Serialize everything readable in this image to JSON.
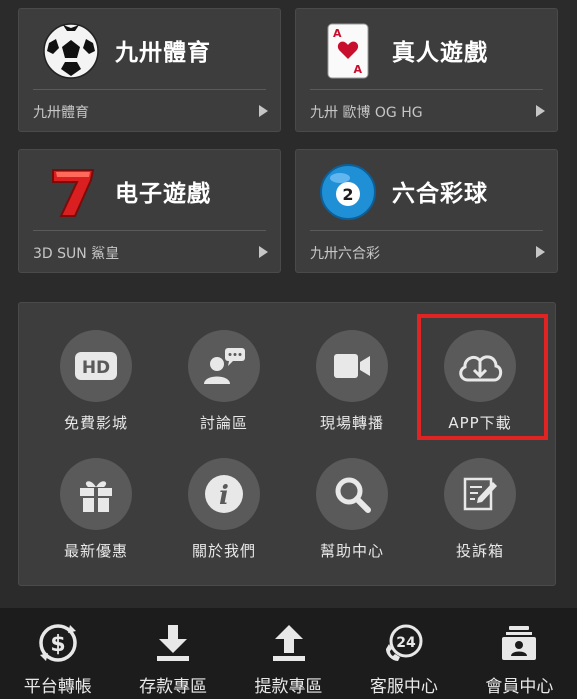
{
  "cards": [
    {
      "title": "九卅體育",
      "sub": "九卅體育",
      "icon": "soccer-ball-icon"
    },
    {
      "title": "真人遊戲",
      "sub": "九卅 歐博 OG HG",
      "icon": "playing-card-icon"
    },
    {
      "title": "电子遊戲",
      "sub": "3D SUN 鯊皇",
      "icon": "lucky-seven-icon"
    },
    {
      "title": "六合彩球",
      "sub": "九卅六合彩",
      "icon": "lottery-ball-icon"
    }
  ],
  "lottery_ball_number": "2",
  "playing_card": {
    "rank": "A"
  },
  "services": [
    {
      "label": "免費影城",
      "icon": "hd-icon",
      "hd_text": "HD"
    },
    {
      "label": "討論區",
      "icon": "chat-user-icon"
    },
    {
      "label": "現場轉播",
      "icon": "video-camera-icon"
    },
    {
      "label": "APP下載",
      "icon": "cloud-download-icon"
    },
    {
      "label": "最新優惠",
      "icon": "gift-icon"
    },
    {
      "label": "關於我們",
      "icon": "info-icon",
      "info_text": "i"
    },
    {
      "label": "幫助中心",
      "icon": "magnifier-icon"
    },
    {
      "label": "投訴箱",
      "icon": "edit-note-icon"
    }
  ],
  "tabs": [
    {
      "label": "平台轉帳",
      "icon": "dollar-transfer-icon",
      "icon_text": "$"
    },
    {
      "label": "存款專區",
      "icon": "download-arrow-icon"
    },
    {
      "label": "提款專區",
      "icon": "upload-arrow-icon"
    },
    {
      "label": "客服中心",
      "icon": "24h-service-icon",
      "icon_text": "24"
    },
    {
      "label": "會員中心",
      "icon": "member-card-icon"
    }
  ],
  "colors": {
    "background": "#2b2b2b",
    "card": "#3d3d3d",
    "icon_circle": "#5a5a5a",
    "highlight": "#e02424",
    "tabbar": "#1c1c1c"
  }
}
